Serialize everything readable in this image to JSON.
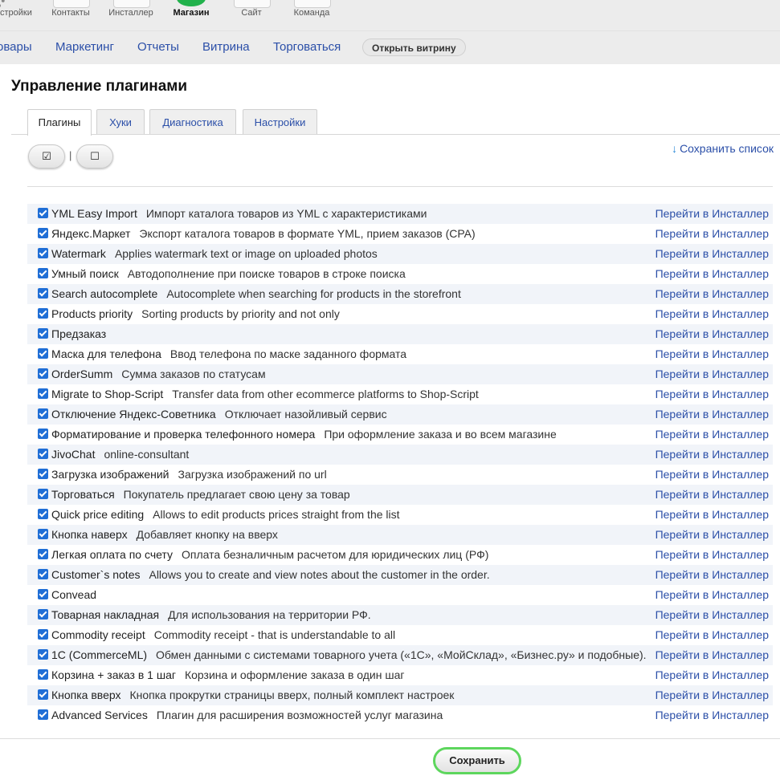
{
  "apps": [
    {
      "label": "стройки"
    },
    {
      "label": "Контакты"
    },
    {
      "label": "Инсталлер"
    },
    {
      "label": "Магазин"
    },
    {
      "label": "Сайт"
    },
    {
      "label": "Команда"
    }
  ],
  "submenu": {
    "items": [
      "овары",
      "Маркетинг",
      "Отчеты",
      "Витрина",
      "Торговаться"
    ],
    "open_storefront": "Открыть витрину"
  },
  "page": {
    "title": "Управление плагинами",
    "tabs": [
      "Плагины",
      "Хуки",
      "Диагностика",
      "Настройки"
    ],
    "check_all": "☑",
    "uncheck_all": "☐",
    "separator": "|",
    "save_list_icon": "↓",
    "save_list": "Сохранить список",
    "save_button": "Сохранить"
  },
  "icons": {
    "check_all": "checkbox-checked-icon",
    "uncheck_all": "checkbox-empty-icon",
    "save_list": "download-arrow-icon"
  },
  "colors": {
    "accent_link": "#2b4fa8",
    "active_app": "#22b24c",
    "save_border": "#5dd65d",
    "checkbox": "#1f6ed6"
  },
  "plugins": [
    {
      "name": "YML Easy Import",
      "desc": "Импорт каталога товаров из YML с характеристиками",
      "link": "Перейти в Инсталлер",
      "checked": true
    },
    {
      "name": "Яндекс.Маркет",
      "desc": "Экспорт каталога товаров в формате YML, прием заказов (CPA)",
      "link": "Перейти в Инсталлер",
      "checked": true
    },
    {
      "name": "Watermark",
      "desc": "Applies watermark text or image on uploaded photos",
      "link": "Перейти в Инсталлер",
      "checked": true
    },
    {
      "name": "Умный поиск",
      "desc": "Автодополнение при поиске товаров в строке поиска",
      "link": "Перейти в Инсталлер",
      "checked": true
    },
    {
      "name": "Search autocomplete",
      "desc": "Autocomplete when searching for products in the storefront",
      "link": "Перейти в Инсталлер",
      "checked": true
    },
    {
      "name": "Products priority",
      "desc": "Sorting products by priority and not only",
      "link": "Перейти в Инсталлер",
      "checked": true
    },
    {
      "name": "Предзаказ",
      "desc": "",
      "link": "Перейти в Инсталлер",
      "checked": true
    },
    {
      "name": "Маска для телефона",
      "desc": "Ввод телефона по маске заданного формата",
      "link": "Перейти в Инсталлер",
      "checked": true
    },
    {
      "name": "OrderSumm",
      "desc": "Сумма заказов по статусам",
      "link": "Перейти в Инсталлер",
      "checked": true
    },
    {
      "name": "Migrate to Shop-Script",
      "desc": "Transfer data from other ecommerce platforms to Shop-Script",
      "link": "Перейти в Инсталлер",
      "checked": true
    },
    {
      "name": "Отключение Яндекс-Советника",
      "desc": "Отключает назойливый сервис",
      "link": "Перейти в Инсталлер",
      "checked": true
    },
    {
      "name": "Форматирование и проверка телефонного номера",
      "desc": "При оформление заказа и во всем магазине",
      "link": "Перейти в Инсталлер",
      "checked": true
    },
    {
      "name": "JivoChat",
      "desc": "online-consultant",
      "link": "Перейти в Инсталлер",
      "checked": true
    },
    {
      "name": "Загрузка изображений",
      "desc": "Загрузка изображений по url",
      "link": "Перейти в Инсталлер",
      "checked": true
    },
    {
      "name": "Торговаться",
      "desc": "Покупатель предлагает свою цену за товар",
      "link": "Перейти в Инсталлер",
      "checked": true
    },
    {
      "name": "Quick price editing",
      "desc": "Allows to edit products prices straight from the list",
      "link": "Перейти в Инсталлер",
      "checked": true
    },
    {
      "name": "Кнопка наверх",
      "desc": "Добавляет кнопку на вверх",
      "link": "Перейти в Инсталлер",
      "checked": true
    },
    {
      "name": "Легкая оплата по счету",
      "desc": "Оплата безналичным расчетом для юридических лиц (РФ)",
      "link": "Перейти в Инсталлер",
      "checked": true
    },
    {
      "name": "Customer`s notes",
      "desc": "Allows you to create and view notes about the customer in the order.",
      "link": "Перейти в Инсталлер",
      "checked": true
    },
    {
      "name": "Convead",
      "desc": "",
      "link": "Перейти в Инсталлер",
      "checked": true
    },
    {
      "name": "Товарная накладная",
      "desc": "Для использования на территории РФ.",
      "link": "Перейти в Инсталлер",
      "checked": true
    },
    {
      "name": "Commodity receipt",
      "desc": "Commodity receipt - that is understandable to all",
      "link": "Перейти в Инсталлер",
      "checked": true
    },
    {
      "name": "1C (CommerceML)",
      "desc": "Обмен данными с системами товарного учета («1С», «МойСклад», «Бизнес.ру» и подобные).",
      "link": "Перейти в Инсталлер",
      "checked": true
    },
    {
      "name": "Корзина + заказ в 1 шаг",
      "desc": "Корзина и оформление заказа в один шаг",
      "link": "Перейти в Инсталлер",
      "checked": true
    },
    {
      "name": "Кнопка вверх",
      "desc": "Кнопка прокрутки страницы вверх, полный комплект настроек",
      "link": "Перейти в Инсталлер",
      "checked": true
    },
    {
      "name": "Advanced Services",
      "desc": "Плагин для расширения возможностей услуг магазина",
      "link": "Перейти в Инсталлер",
      "checked": true
    }
  ]
}
